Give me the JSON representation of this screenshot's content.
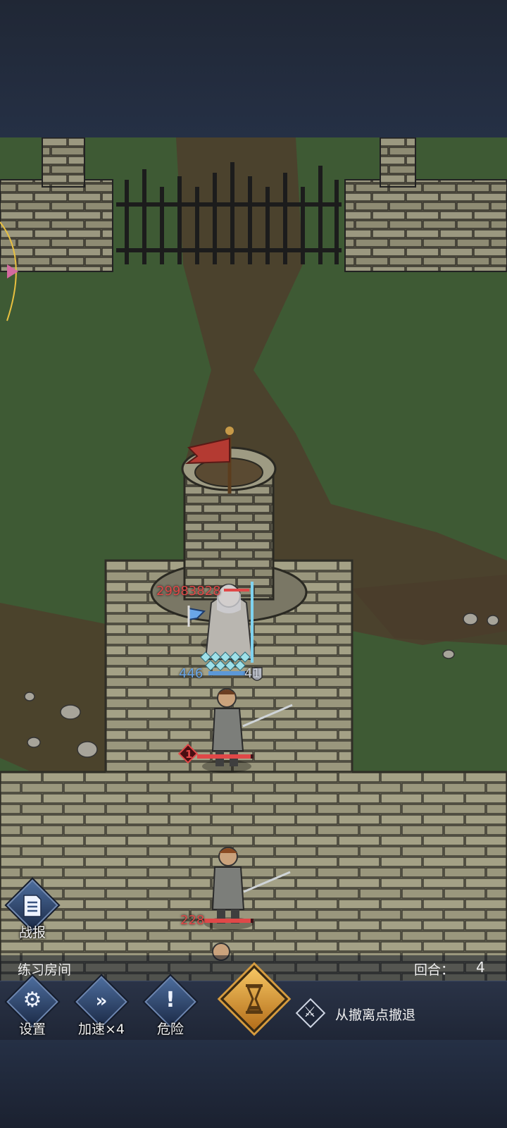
{
  "hud": {
    "room_name": "练习房间",
    "turn_label": "回合：",
    "turn_value": "4"
  },
  "units": {
    "boss_hp": "29983828",
    "hero_hp": "446",
    "hero_armor": "41",
    "enemy1_level": "1",
    "enemy2_hp": "228"
  },
  "buttons": {
    "report": {
      "label": "战报",
      "icon": "document-icon"
    },
    "settings": {
      "label": "设置",
      "icon": "gear-icon"
    },
    "speed": {
      "label": "加速×4",
      "icon": "fast-forward-icon"
    },
    "danger": {
      "label": "危险",
      "icon": "exclamation-icon"
    },
    "end_turn": {
      "icon": "hourglass-icon"
    },
    "retreat": {
      "label": "从撤离点撤退",
      "icon": "crossed-swords-icon"
    }
  },
  "colors": {
    "hp_red": "#e04848",
    "hero_blue": "#6aa6e8",
    "end_turn_gold": "#e8aa45",
    "button_blue": "#3a5480"
  }
}
